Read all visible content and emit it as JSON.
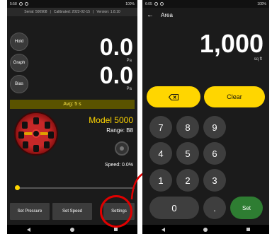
{
  "left": {
    "status": {
      "time": "5:58",
      "battery": "100%"
    },
    "info": {
      "serial": "Serial: 500908",
      "calibrated": "Calibrated: 2022-02-15",
      "version": "Version: 1.8.10"
    },
    "side_buttons": {
      "hold": "Hold",
      "graph": "Graph",
      "bias": "Bias"
    },
    "channel1": {
      "value": "0.0",
      "unit": "Pa"
    },
    "channel2": {
      "value": "0.0",
      "unit": "Pa"
    },
    "avg": "Avg: 5 s",
    "model": "Model 5000",
    "range": "Range: B8",
    "speed": "Speed: 0.0%",
    "speed_fraction": 0.0,
    "buttons": {
      "set_pressure": "Set Pressure",
      "set_speed": "Set Speed",
      "settings": "Settings"
    }
  },
  "right": {
    "status": {
      "time": "6:05",
      "battery": "100%"
    },
    "title": "Area",
    "value": "1,000",
    "unit": "sq ft",
    "clear": "Clear",
    "keys": [
      "7",
      "8",
      "9",
      "4",
      "5",
      "6",
      "1",
      "2",
      "3",
      "0",
      "."
    ],
    "set": "Set"
  },
  "colors": {
    "accent": "#ffd600",
    "highlight": "#e00000",
    "set_button": "#2e7d32"
  }
}
